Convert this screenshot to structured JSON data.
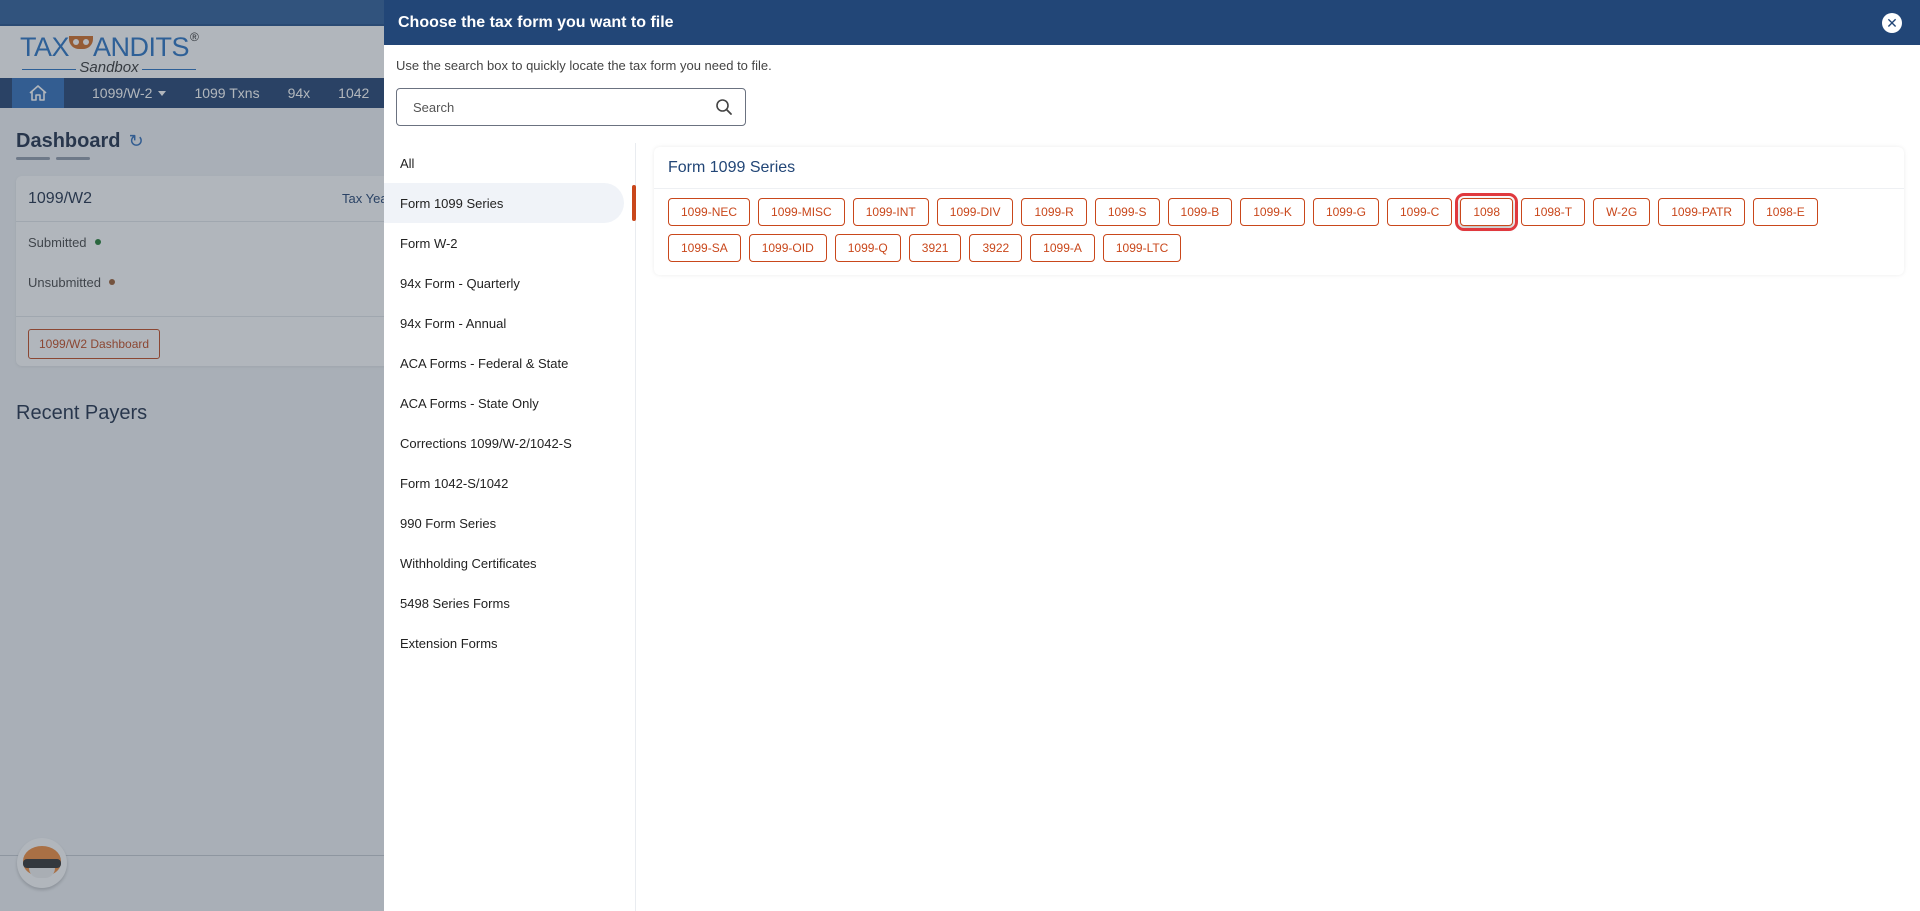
{
  "background": {
    "logo": {
      "brand": "TAXBANDITS",
      "brand_left": "TAX",
      "brand_right": "ANDITS",
      "registered": "®",
      "subtitle": "Sandbox"
    },
    "nav": {
      "items": [
        {
          "label": "1099/W-2",
          "has_dropdown": true
        },
        {
          "label": "1099 Txns"
        },
        {
          "label": "94x"
        },
        {
          "label": "1042"
        }
      ]
    },
    "dashboard": {
      "title": "Dashboard",
      "card": {
        "title": "1099/W2",
        "tax_year_label": "Tax Yea",
        "rows": [
          {
            "label": "Submitted",
            "dot_color": "#1e7a2e"
          },
          {
            "label": "Unsubmitted",
            "dot_color": "#9a5a2e"
          }
        ],
        "button_label": "1099/W2 Dashboard"
      },
      "recent_payers_title": "Recent Payers"
    }
  },
  "modal": {
    "title": "Choose the tax form you want to file",
    "close_icon": "close-icon",
    "hint": "Use the search box to quickly locate the tax form you need to file.",
    "search": {
      "placeholder": "Search",
      "value": ""
    },
    "categories": [
      {
        "label": "All",
        "active": false
      },
      {
        "label": "Form 1099 Series",
        "active": true
      },
      {
        "label": "Form W-2",
        "active": false
      },
      {
        "label": "94x Form - Quarterly",
        "active": false
      },
      {
        "label": "94x Form - Annual",
        "active": false
      },
      {
        "label": "ACA Forms - Federal & State",
        "active": false
      },
      {
        "label": "ACA Forms - State Only",
        "active": false
      },
      {
        "label": "Corrections 1099/W-2/1042-S",
        "active": false
      },
      {
        "label": "Form 1042-S/1042",
        "active": false
      },
      {
        "label": "990 Form Series",
        "active": false
      },
      {
        "label": "Withholding Certificates",
        "active": false
      },
      {
        "label": "5498 Series Forms",
        "active": false
      },
      {
        "label": "Extension Forms",
        "active": false
      }
    ],
    "section": {
      "title": "Form 1099 Series",
      "forms": [
        "1099-NEC",
        "1099-MISC",
        "1099-INT",
        "1099-DIV",
        "1099-R",
        "1099-S",
        "1099-B",
        "1099-K",
        "1099-G",
        "1099-C",
        "1098",
        "1098-T",
        "W-2G",
        "1099-PATR",
        "1098-E",
        "1099-SA",
        "1099-OID",
        "1099-Q",
        "3921",
        "3922",
        "1099-A",
        "1099-LTC"
      ],
      "highlighted_form": "1098"
    },
    "colors": {
      "header_bg": "#224677",
      "accent": "#c9471b",
      "highlight_outline": "#e0393e"
    }
  }
}
